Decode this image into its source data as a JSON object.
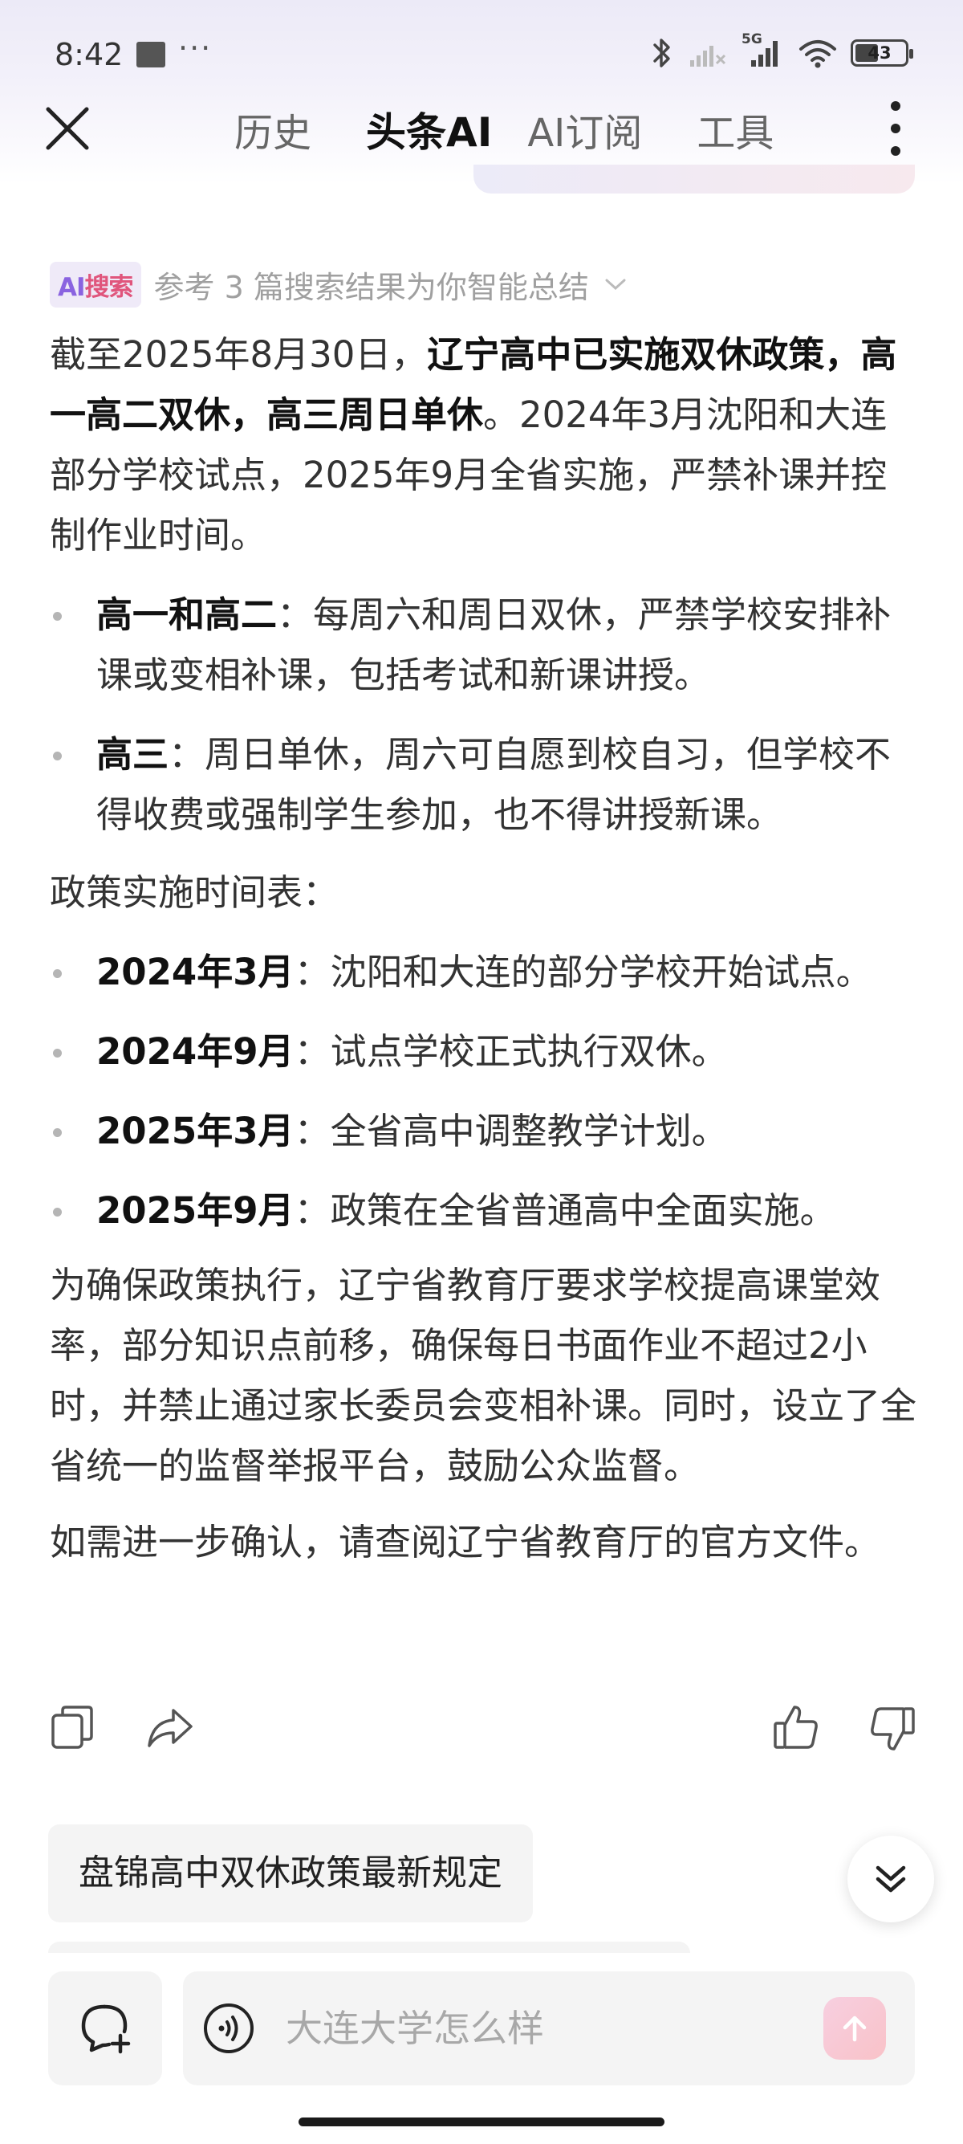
{
  "status_bar": {
    "time": "8:42",
    "dots": "···",
    "network_label": "5G",
    "battery_level": "43"
  },
  "nav": {
    "tabs": [
      {
        "label": "历史"
      },
      {
        "label": "头条AI"
      },
      {
        "label": "AI订阅"
      },
      {
        "label": "工具"
      }
    ],
    "active_tab_index": 1
  },
  "answer": {
    "badge_part1": "AI",
    "badge_part2": "搜索",
    "source_summary": "参考 3 篇搜索结果为你智能总结",
    "intro_prefix": "截至2025年8月30日，",
    "intro_bold": "辽宁高中已实施双休政策，高一高二双休，高三周日单休",
    "intro_suffix": "。2024年3月沈阳和大连部分学校试点，2025年9月全省实施，严禁补课并控制作业时间。",
    "grade_bullets": [
      {
        "term": "高一和高二",
        "text": "：每周六和周日双休，严禁学校安排补课或变相补课，包括考试和新课讲授。"
      },
      {
        "term": "高三",
        "text": "：周日单休，周六可自愿到校自习，但学校不得收费或强制学生参加，也不得讲授新课。"
      }
    ],
    "timeline_heading": "政策实施时间表：",
    "timeline": [
      {
        "term": "2024年3月",
        "text": "：沈阳和大连的部分学校开始试点。"
      },
      {
        "term": "2024年9月",
        "text": "：试点学校正式执行双休。"
      },
      {
        "term": "2025年3月",
        "text": "：全省高中调整教学计划。"
      },
      {
        "term": "2025年9月",
        "text": "：政策在全省普通高中全面实施。"
      }
    ],
    "enforcement": "为确保政策执行，辽宁省教育厅要求学校提高课堂效率，部分知识点前移，确保每日书面作业不超过2小时，并禁止通过家长委员会变相补课。同时，设立了全省统一的监督举报平台，鼓励公众监督。",
    "closing": "如需进一步确认，请查阅辽宁省教育厅的官方文件。"
  },
  "suggestion": {
    "label": "盘锦高中双休政策最新规定"
  },
  "input": {
    "placeholder": "大连大学怎么样",
    "value": ""
  },
  "colors": {
    "accent_purple": "#8a63e0",
    "accent_pink": "#e0557c",
    "text_primary": "#111111",
    "text_secondary": "#a0a0a0"
  }
}
